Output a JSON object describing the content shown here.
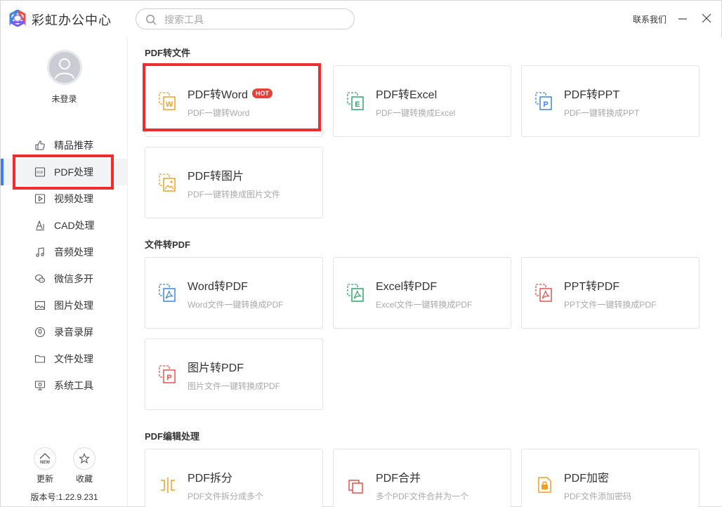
{
  "app": {
    "title": "彩虹办公中心"
  },
  "search": {
    "placeholder": "搜索工具"
  },
  "header": {
    "contact_label": "联系我们"
  },
  "user": {
    "login_status": "未登录"
  },
  "sidebar": {
    "items": [
      {
        "label": "精品推荐",
        "icon": "thumbs-up-icon"
      },
      {
        "label": "PDF处理",
        "icon": "pdf-icon",
        "active": true
      },
      {
        "label": "视频处理",
        "icon": "video-icon"
      },
      {
        "label": "CAD处理",
        "icon": "cad-icon"
      },
      {
        "label": "音频处理",
        "icon": "music-icon"
      },
      {
        "label": "微信多开",
        "icon": "wechat-icon"
      },
      {
        "label": "图片处理",
        "icon": "image-icon"
      },
      {
        "label": "录音录屏",
        "icon": "record-icon"
      },
      {
        "label": "文件处理",
        "icon": "folder-icon"
      },
      {
        "label": "系统工具",
        "icon": "system-icon"
      }
    ],
    "update_label": "更新",
    "update_badge": "NEW",
    "favorite_label": "收藏",
    "version": "版本号:1.22.9.231"
  },
  "sections": [
    {
      "title": "PDF转文件",
      "cards": [
        {
          "title": "PDF转Word",
          "subtitle": "PDF一键转Word",
          "badge": "HOT",
          "icon_letter": "W",
          "color": "#f0a020"
        },
        {
          "title": "PDF转Excel",
          "subtitle": "PDF一键转换成Excel",
          "icon_letter": "E",
          "color": "#2fa86a"
        },
        {
          "title": "PDF转PPT",
          "subtitle": "PDF一键转换成PPT",
          "icon_letter": "P",
          "color": "#3a86e0"
        },
        {
          "title": "PDF转图片",
          "subtitle": "PDF一键转换成图片文件",
          "icon_letter": "",
          "color": "#f0a020"
        }
      ]
    },
    {
      "title": "文件转PDF",
      "cards": [
        {
          "title": "Word转PDF",
          "subtitle": "Word文件一键转换成PDF",
          "icon_letter": "",
          "color": "#3a86e0"
        },
        {
          "title": "Excel转PDF",
          "subtitle": "Excel文件一键转换成PDF",
          "icon_letter": "",
          "color": "#2fa86a"
        },
        {
          "title": "PPT转PDF",
          "subtitle": "PPT文件一键转换成PDF",
          "icon_letter": "",
          "color": "#e8504a"
        },
        {
          "title": "图片转PDF",
          "subtitle": "图片文件一键转换成PDF",
          "icon_letter": "P",
          "color": "#e8504a"
        }
      ]
    },
    {
      "title": "PDF编辑处理",
      "cards": [
        {
          "title": "PDF拆分",
          "subtitle": "PDF文件拆分成多个",
          "icon_letter": "",
          "color": "#f0a020"
        },
        {
          "title": "PDF合并",
          "subtitle": "多个PDF文件合并为一个",
          "icon_letter": "",
          "color": "#e8504a"
        },
        {
          "title": "PDF加密",
          "subtitle": "PDF文件添加密码",
          "icon_letter": "",
          "color": "#f0a020"
        }
      ]
    }
  ]
}
